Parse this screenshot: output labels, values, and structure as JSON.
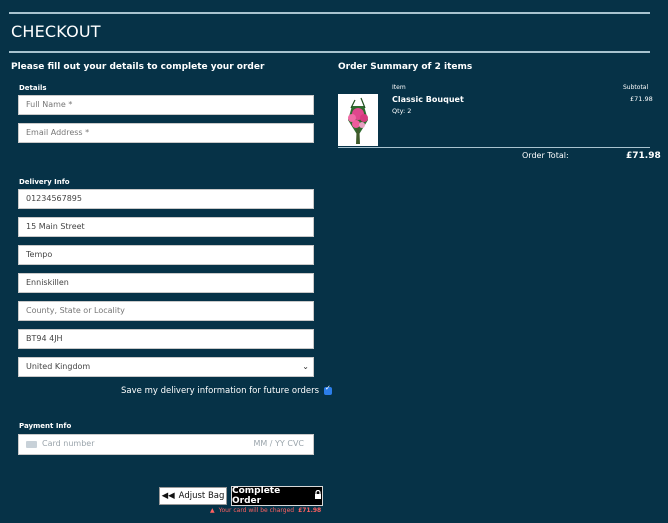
{
  "header": {
    "title": "CHECKOUT"
  },
  "form": {
    "lead": "Please fill out your details to complete your order",
    "details_label": "Details",
    "full_name_placeholder": "Full Name *",
    "email_placeholder": "Email Address *",
    "delivery_label": "Delivery Info",
    "phone": "01234567895",
    "street": "15 Main Street",
    "town": "Tempo",
    "county_city": "Enniskillen",
    "county_placeholder": "County, State or Locality",
    "postcode": "BT94 4JH",
    "country": "United Kingdom",
    "save_label": "Save my delivery information for future orders",
    "payment_label": "Payment Info",
    "card_placeholder": "Card number",
    "card_date_cvc": "MM / YY  CVC"
  },
  "actions": {
    "adjust_label": "Adjust Bag",
    "complete_label": "Complete Order",
    "warning_text": "Your card will be charged",
    "warning_amount": "£71.98"
  },
  "summary": {
    "title": "Order Summary of 2 items",
    "col_item": "Item",
    "col_subtotal": "Subtotal",
    "product_name": "Classic Bouquet",
    "qty": "Qty: 2",
    "subtotal": "£71.98",
    "total_label": "Order Total:",
    "total_value": "£71.98"
  },
  "icons": {
    "adjust": "rewind-icon",
    "lock": "lock-icon",
    "warning": "warning-icon",
    "card": "card-icon"
  }
}
